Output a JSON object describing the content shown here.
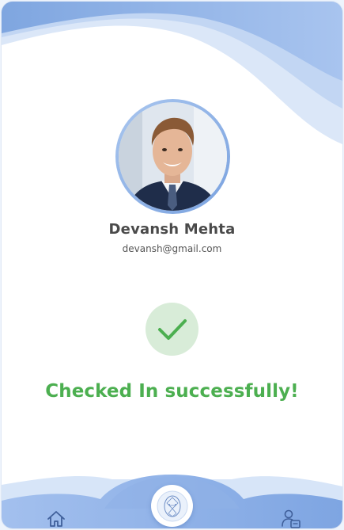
{
  "user": {
    "name": "Devansh Mehta",
    "email": "devansh@gmail.com"
  },
  "status": {
    "message": "Checked In successfully!"
  },
  "nav": {
    "home_icon": "home-icon",
    "scan_icon": "face-scan-icon",
    "profile_icon": "user-badge-icon"
  },
  "colors": {
    "accent": "#7aa2df",
    "success": "#4caf50",
    "success_bg": "#d8ecd8",
    "nav_icon": "#3f5f9a"
  }
}
